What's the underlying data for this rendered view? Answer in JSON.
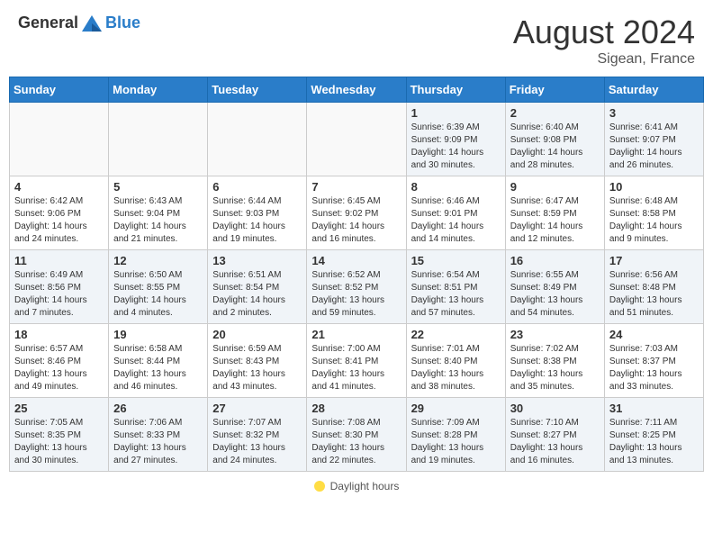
{
  "header": {
    "logo_general": "General",
    "logo_blue": "Blue",
    "month_year": "August 2024",
    "location": "Sigean, France"
  },
  "footer": {
    "legend_label": "Daylight hours"
  },
  "calendar": {
    "days_of_week": [
      "Sunday",
      "Monday",
      "Tuesday",
      "Wednesday",
      "Thursday",
      "Friday",
      "Saturday"
    ],
    "weeks": [
      [
        {
          "day": "",
          "info": ""
        },
        {
          "day": "",
          "info": ""
        },
        {
          "day": "",
          "info": ""
        },
        {
          "day": "",
          "info": ""
        },
        {
          "day": "1",
          "info": "Sunrise: 6:39 AM\nSunset: 9:09 PM\nDaylight: 14 hours and 30 minutes."
        },
        {
          "day": "2",
          "info": "Sunrise: 6:40 AM\nSunset: 9:08 PM\nDaylight: 14 hours and 28 minutes."
        },
        {
          "day": "3",
          "info": "Sunrise: 6:41 AM\nSunset: 9:07 PM\nDaylight: 14 hours and 26 minutes."
        }
      ],
      [
        {
          "day": "4",
          "info": "Sunrise: 6:42 AM\nSunset: 9:06 PM\nDaylight: 14 hours and 24 minutes."
        },
        {
          "day": "5",
          "info": "Sunrise: 6:43 AM\nSunset: 9:04 PM\nDaylight: 14 hours and 21 minutes."
        },
        {
          "day": "6",
          "info": "Sunrise: 6:44 AM\nSunset: 9:03 PM\nDaylight: 14 hours and 19 minutes."
        },
        {
          "day": "7",
          "info": "Sunrise: 6:45 AM\nSunset: 9:02 PM\nDaylight: 14 hours and 16 minutes."
        },
        {
          "day": "8",
          "info": "Sunrise: 6:46 AM\nSunset: 9:01 PM\nDaylight: 14 hours and 14 minutes."
        },
        {
          "day": "9",
          "info": "Sunrise: 6:47 AM\nSunset: 8:59 PM\nDaylight: 14 hours and 12 minutes."
        },
        {
          "day": "10",
          "info": "Sunrise: 6:48 AM\nSunset: 8:58 PM\nDaylight: 14 hours and 9 minutes."
        }
      ],
      [
        {
          "day": "11",
          "info": "Sunrise: 6:49 AM\nSunset: 8:56 PM\nDaylight: 14 hours and 7 minutes."
        },
        {
          "day": "12",
          "info": "Sunrise: 6:50 AM\nSunset: 8:55 PM\nDaylight: 14 hours and 4 minutes."
        },
        {
          "day": "13",
          "info": "Sunrise: 6:51 AM\nSunset: 8:54 PM\nDaylight: 14 hours and 2 minutes."
        },
        {
          "day": "14",
          "info": "Sunrise: 6:52 AM\nSunset: 8:52 PM\nDaylight: 13 hours and 59 minutes."
        },
        {
          "day": "15",
          "info": "Sunrise: 6:54 AM\nSunset: 8:51 PM\nDaylight: 13 hours and 57 minutes."
        },
        {
          "day": "16",
          "info": "Sunrise: 6:55 AM\nSunset: 8:49 PM\nDaylight: 13 hours and 54 minutes."
        },
        {
          "day": "17",
          "info": "Sunrise: 6:56 AM\nSunset: 8:48 PM\nDaylight: 13 hours and 51 minutes."
        }
      ],
      [
        {
          "day": "18",
          "info": "Sunrise: 6:57 AM\nSunset: 8:46 PM\nDaylight: 13 hours and 49 minutes."
        },
        {
          "day": "19",
          "info": "Sunrise: 6:58 AM\nSunset: 8:44 PM\nDaylight: 13 hours and 46 minutes."
        },
        {
          "day": "20",
          "info": "Sunrise: 6:59 AM\nSunset: 8:43 PM\nDaylight: 13 hours and 43 minutes."
        },
        {
          "day": "21",
          "info": "Sunrise: 7:00 AM\nSunset: 8:41 PM\nDaylight: 13 hours and 41 minutes."
        },
        {
          "day": "22",
          "info": "Sunrise: 7:01 AM\nSunset: 8:40 PM\nDaylight: 13 hours and 38 minutes."
        },
        {
          "day": "23",
          "info": "Sunrise: 7:02 AM\nSunset: 8:38 PM\nDaylight: 13 hours and 35 minutes."
        },
        {
          "day": "24",
          "info": "Sunrise: 7:03 AM\nSunset: 8:37 PM\nDaylight: 13 hours and 33 minutes."
        }
      ],
      [
        {
          "day": "25",
          "info": "Sunrise: 7:05 AM\nSunset: 8:35 PM\nDaylight: 13 hours and 30 minutes."
        },
        {
          "day": "26",
          "info": "Sunrise: 7:06 AM\nSunset: 8:33 PM\nDaylight: 13 hours and 27 minutes."
        },
        {
          "day": "27",
          "info": "Sunrise: 7:07 AM\nSunset: 8:32 PM\nDaylight: 13 hours and 24 minutes."
        },
        {
          "day": "28",
          "info": "Sunrise: 7:08 AM\nSunset: 8:30 PM\nDaylight: 13 hours and 22 minutes."
        },
        {
          "day": "29",
          "info": "Sunrise: 7:09 AM\nSunset: 8:28 PM\nDaylight: 13 hours and 19 minutes."
        },
        {
          "day": "30",
          "info": "Sunrise: 7:10 AM\nSunset: 8:27 PM\nDaylight: 13 hours and 16 minutes."
        },
        {
          "day": "31",
          "info": "Sunrise: 7:11 AM\nSunset: 8:25 PM\nDaylight: 13 hours and 13 minutes."
        }
      ]
    ]
  }
}
